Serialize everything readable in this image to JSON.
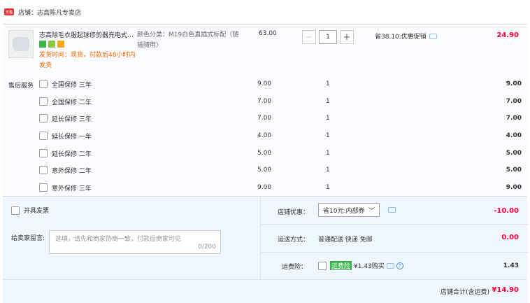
{
  "shop": {
    "badge": "天猫",
    "name": "店铺：志高陈凡专卖店"
  },
  "item": {
    "title": "志高除毛衣服起球修剪器充电式…",
    "shipping": "发货时间：现货，付款后48小时内发货",
    "sku": "颜色分类：M19白色直插式标配（随插随用）",
    "price": "63.00",
    "quantity": "1",
    "minus": "−",
    "plus": "+",
    "discount": "省38.10:优惠促销",
    "total": "24.90"
  },
  "services": {
    "label": "售后服务",
    "rows": [
      {
        "name": "全国保修 三年",
        "price": "9.00",
        "qty": "1",
        "sub": "9.00"
      },
      {
        "name": "全国保修 二年",
        "price": "7.00",
        "qty": "1",
        "sub": "7.00"
      },
      {
        "name": "延长保修 三年",
        "price": "7.00",
        "qty": "1",
        "sub": "7.00"
      },
      {
        "name": "延长保修 一年",
        "price": "4.00",
        "qty": "1",
        "sub": "4.00"
      },
      {
        "name": "延长保修 二年",
        "price": "5.00",
        "qty": "1",
        "sub": "5.00"
      },
      {
        "name": "意外保修 二年",
        "price": "5.00",
        "qty": "1",
        "sub": "5.00"
      },
      {
        "name": "意外保修 三年",
        "price": "9.00",
        "qty": "1",
        "sub": "9.00"
      }
    ]
  },
  "invoice": {
    "label": "开具发票"
  },
  "message": {
    "label": "给卖家留言:",
    "placeholder": "选填，请先和商家协商一致，付款后商家可见",
    "counter": "0/200"
  },
  "coupon": {
    "label": "店铺优惠：",
    "selected": "省10元:内部券",
    "value": "-10.00"
  },
  "delivery": {
    "label": "运送方式：",
    "method": "普通配送 快递 免邮",
    "value": "0.00"
  },
  "insurance": {
    "label": "运费险：",
    "tag": "运费险",
    "text": "¥1.43购买",
    "help": "?",
    "value": "1.43"
  },
  "summary": {
    "label": "店铺合计(含运费)",
    "total": "¥14.90"
  }
}
